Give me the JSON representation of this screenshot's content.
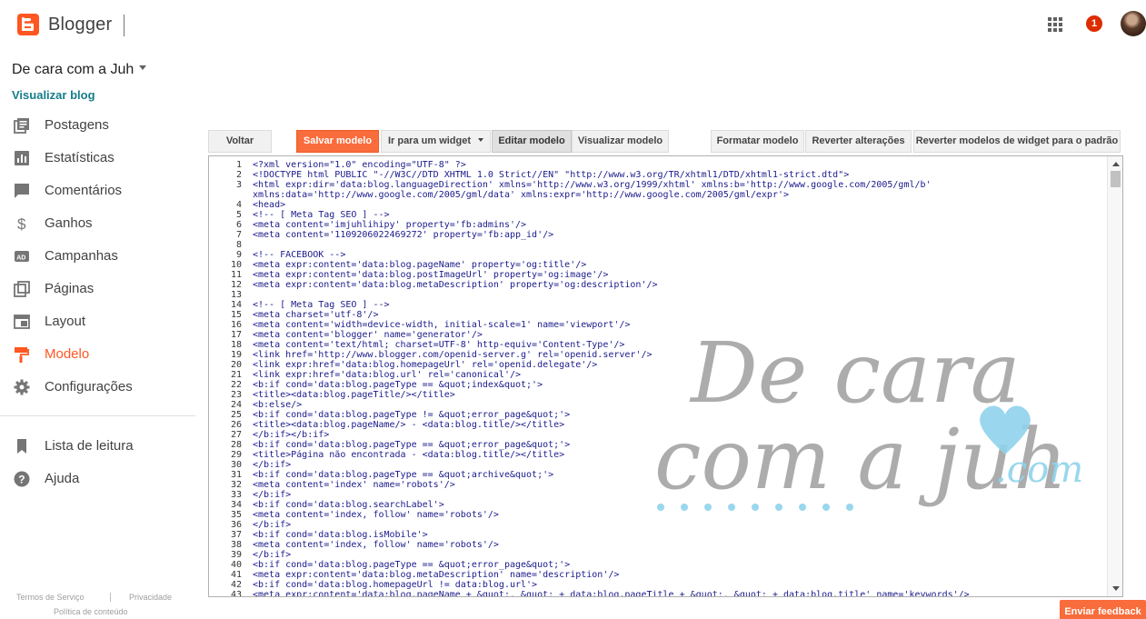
{
  "header": {
    "brand": "Blogger",
    "notifications_count": "1",
    "icons": {
      "logo": "blogger-logo-icon",
      "apps": "apps-grid-icon",
      "avatar": "user-avatar"
    }
  },
  "sidebar": {
    "blog_title": "De cara com a Juh",
    "view_blog": "Visualizar blog",
    "items": [
      {
        "label": "Postagens",
        "icon": "posts-icon"
      },
      {
        "label": "Estatísticas",
        "icon": "stats-icon"
      },
      {
        "label": "Comentários",
        "icon": "comments-icon"
      },
      {
        "label": "Ganhos",
        "icon": "dollar-icon"
      },
      {
        "label": "Campanhas",
        "icon": "ads-icon"
      },
      {
        "label": "Páginas",
        "icon": "pages-icon"
      },
      {
        "label": "Layout",
        "icon": "layout-icon"
      },
      {
        "label": "Modelo",
        "icon": "theme-icon",
        "active": true
      },
      {
        "label": "Configurações",
        "icon": "gear-icon"
      }
    ],
    "secondary": [
      {
        "label": "Lista de leitura",
        "icon": "bookmark-icon"
      },
      {
        "label": "Ajuda",
        "icon": "help-icon"
      }
    ],
    "footer": {
      "terms": "Termos de Serviço",
      "privacy": "Privacidade",
      "content_policy": "Política de conteúdo"
    }
  },
  "toolbar": {
    "back": "Voltar",
    "save": "Salvar modelo",
    "jump_to_widget": "Ir para um widget",
    "edit_template": "Editar modelo",
    "preview_template": "Visualizar modelo",
    "format_template": "Formatar modelo",
    "revert_changes": "Reverter alterações",
    "revert_widgets": "Reverter modelos de widget para o padrão"
  },
  "editor": {
    "lines": [
      "<?xml version=\"1.0\" encoding=\"UTF-8\" ?>",
      "<!DOCTYPE html PUBLIC \"-//W3C//DTD XHTML 1.0 Strict//EN\" \"http://www.w3.org/TR/xhtml1/DTD/xhtml1-strict.dtd\">",
      "<html expr:dir='data:blog.languageDirection' xmlns='http://www.w3.org/1999/xhtml' xmlns:b='http://www.google.com/2005/gml/b'",
      "xmlns:data='http://www.google.com/2005/gml/data' xmlns:expr='http://www.google.com/2005/gml/expr'>",
      "<head>",
      "<!-- [ Meta Tag SEO ] -->",
      "<meta content='imjuhlihipy' property='fb:admins'/>",
      "<meta content='1109206022469272' property='fb:app_id'/>",
      "",
      "<!-- FACEBOOK -->",
      "<meta expr:content='data:blog.pageName' property='og:title'/>",
      "<meta expr:content='data:blog.postImageUrl' property='og:image'/>",
      "<meta expr:content='data:blog.metaDescription' property='og:description'/>",
      "",
      "<!-- [ Meta Tag SEO ] -->",
      "<meta charset='utf-8'/>",
      "<meta content='width=device-width, initial-scale=1' name='viewport'/>",
      "<meta content='blogger' name='generator'/>",
      "<meta content='text/html; charset=UTF-8' http-equiv='Content-Type'/>",
      "<link href='http://www.blogger.com/openid-server.g' rel='openid.server'/>",
      "<link expr:href='data:blog.homepageUrl' rel='openid.delegate'/>",
      "<link expr:href='data:blog.url' rel='canonical'/>",
      "<b:if cond='data:blog.pageType == &quot;index&quot;'>",
      "<title><data:blog.pageTitle/></title>",
      "<b:else/>",
      "<b:if cond='data:blog.pageType != &quot;error_page&quot;'>",
      "<title><data:blog.pageName/> - <data:blog.title/></title>",
      "</b:if></b:if>",
      "<b:if cond='data:blog.pageType == &quot;error_page&quot;'>",
      "<title>Página não encontrada - <data:blog.title/></title>",
      "</b:if>",
      "<b:if cond='data:blog.pageType == &quot;archive&quot;'>",
      "<meta content='index' name='robots'/>",
      "</b:if>",
      "<b:if cond='data:blog.searchLabel'>",
      "<meta content='index, follow' name='robots'/>",
      "</b:if>",
      "<b:if cond='data:blog.isMobile'>",
      "<meta content='index, follow' name='robots'/>",
      "</b:if>",
      "<b:if cond='data:blog.pageType == &quot;error_page&quot;'>",
      "<meta expr:content='data:blog.metaDescription' name='description'/>",
      "<b:if cond='data:blog.homepageUrl != data:blog.url'>",
      "<meta expr:content='data:blog.pageName + &quot;, &quot; + data:blog.pageTitle + &quot;, &quot; + data:blog.title' name='keywords'/>"
    ],
    "line_numbers": [
      "1",
      "2",
      "3",
      "",
      "4",
      "5",
      "6",
      "7",
      "8",
      "9",
      "10",
      "11",
      "12",
      "13",
      "14",
      "15",
      "16",
      "17",
      "18",
      "19",
      "20",
      "21",
      "22",
      "23",
      "24",
      "25",
      "26",
      "27",
      "28",
      "29",
      "30",
      "31",
      "32",
      "33",
      "34",
      "35",
      "36",
      "37",
      "38",
      "39",
      "40",
      "41",
      "42",
      "43"
    ]
  },
  "watermark": {
    "line1": "De cara",
    "line2": "com a juh",
    "suffix": ".com",
    "color": "#9e9e9e",
    "accent": "#8fd3ec"
  },
  "feedback_button": "Enviar feedback",
  "colors": {
    "accent": "#ff5722",
    "link": "#167d8a",
    "primary_button": "#f96c3b"
  }
}
